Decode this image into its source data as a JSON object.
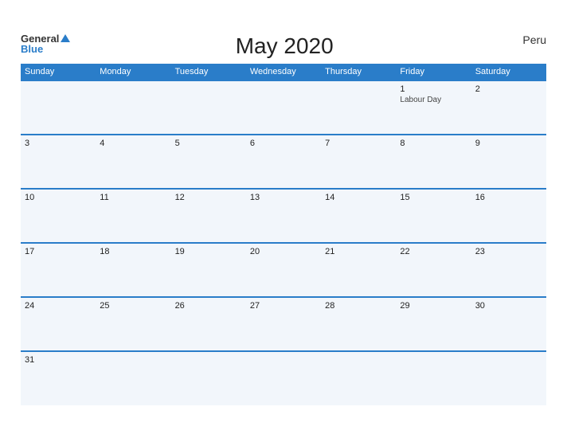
{
  "header": {
    "logo_general": "General",
    "logo_blue": "Blue",
    "title": "May 2020",
    "country": "Peru"
  },
  "days_of_week": [
    "Sunday",
    "Monday",
    "Tuesday",
    "Wednesday",
    "Thursday",
    "Friday",
    "Saturday"
  ],
  "weeks": [
    [
      {
        "day": "",
        "event": ""
      },
      {
        "day": "",
        "event": ""
      },
      {
        "day": "",
        "event": ""
      },
      {
        "day": "",
        "event": ""
      },
      {
        "day": "",
        "event": ""
      },
      {
        "day": "1",
        "event": "Labour Day"
      },
      {
        "day": "2",
        "event": ""
      }
    ],
    [
      {
        "day": "3",
        "event": ""
      },
      {
        "day": "4",
        "event": ""
      },
      {
        "day": "5",
        "event": ""
      },
      {
        "day": "6",
        "event": ""
      },
      {
        "day": "7",
        "event": ""
      },
      {
        "day": "8",
        "event": ""
      },
      {
        "day": "9",
        "event": ""
      }
    ],
    [
      {
        "day": "10",
        "event": ""
      },
      {
        "day": "11",
        "event": ""
      },
      {
        "day": "12",
        "event": ""
      },
      {
        "day": "13",
        "event": ""
      },
      {
        "day": "14",
        "event": ""
      },
      {
        "day": "15",
        "event": ""
      },
      {
        "day": "16",
        "event": ""
      }
    ],
    [
      {
        "day": "17",
        "event": ""
      },
      {
        "day": "18",
        "event": ""
      },
      {
        "day": "19",
        "event": ""
      },
      {
        "day": "20",
        "event": ""
      },
      {
        "day": "21",
        "event": ""
      },
      {
        "day": "22",
        "event": ""
      },
      {
        "day": "23",
        "event": ""
      }
    ],
    [
      {
        "day": "24",
        "event": ""
      },
      {
        "day": "25",
        "event": ""
      },
      {
        "day": "26",
        "event": ""
      },
      {
        "day": "27",
        "event": ""
      },
      {
        "day": "28",
        "event": ""
      },
      {
        "day": "29",
        "event": ""
      },
      {
        "day": "30",
        "event": ""
      }
    ],
    [
      {
        "day": "31",
        "event": ""
      },
      {
        "day": "",
        "event": ""
      },
      {
        "day": "",
        "event": ""
      },
      {
        "day": "",
        "event": ""
      },
      {
        "day": "",
        "event": ""
      },
      {
        "day": "",
        "event": ""
      },
      {
        "day": "",
        "event": ""
      }
    ]
  ]
}
